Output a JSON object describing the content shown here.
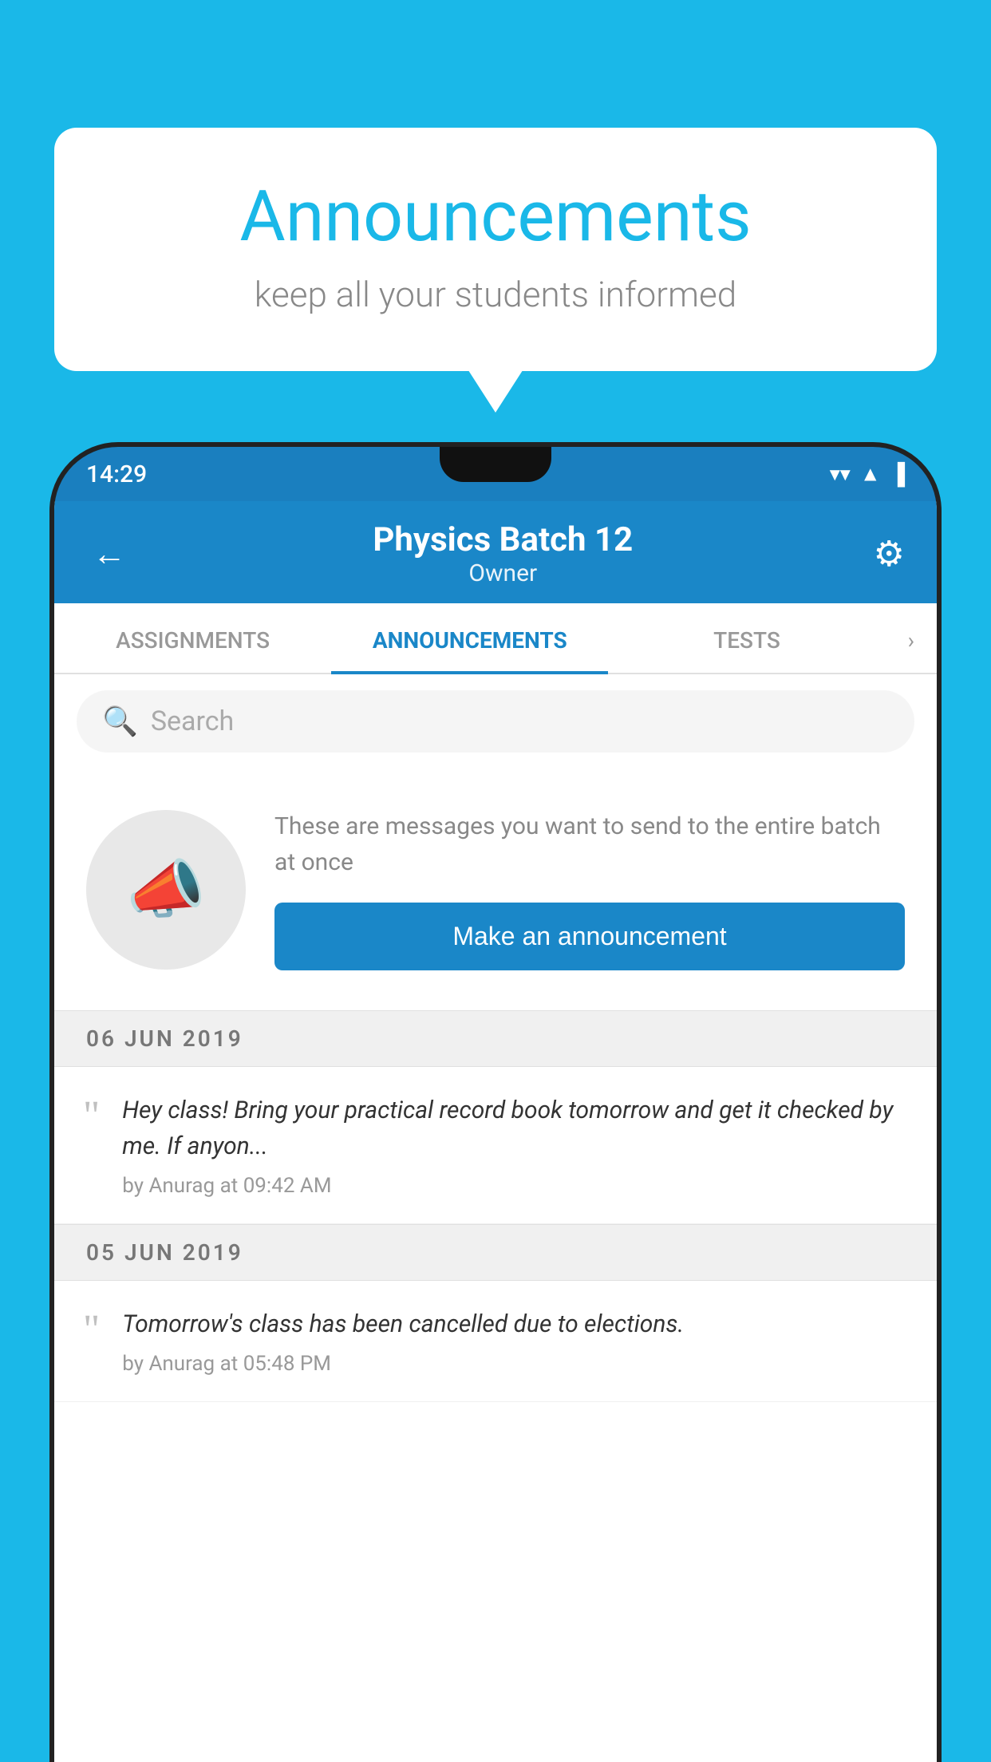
{
  "background": {
    "color": "#1ab8e8"
  },
  "speech_bubble": {
    "title": "Announcements",
    "subtitle": "keep all your students informed"
  },
  "status_bar": {
    "time": "14:29",
    "icons": [
      "wifi",
      "signal",
      "battery"
    ]
  },
  "app_header": {
    "title": "Physics Batch 12",
    "subtitle": "Owner",
    "back_icon": "←",
    "gear_icon": "⚙"
  },
  "tabs": [
    {
      "label": "ASSIGNMENTS",
      "active": false
    },
    {
      "label": "ANNOUNCEMENTS",
      "active": true
    },
    {
      "label": "TESTS",
      "active": false
    }
  ],
  "search": {
    "placeholder": "Search"
  },
  "empty_state": {
    "description": "These are messages you want to send to the entire batch at once",
    "button_label": "Make an announcement"
  },
  "announcements": [
    {
      "date": "06  JUN  2019",
      "text": "Hey class! Bring your practical record book tomorrow and get it checked by me. If anyon...",
      "meta": "by Anurag at 09:42 AM"
    },
    {
      "date": "05  JUN  2019",
      "text": "Tomorrow's class has been cancelled due to elections.",
      "meta": "by Anurag at 05:48 PM"
    }
  ]
}
